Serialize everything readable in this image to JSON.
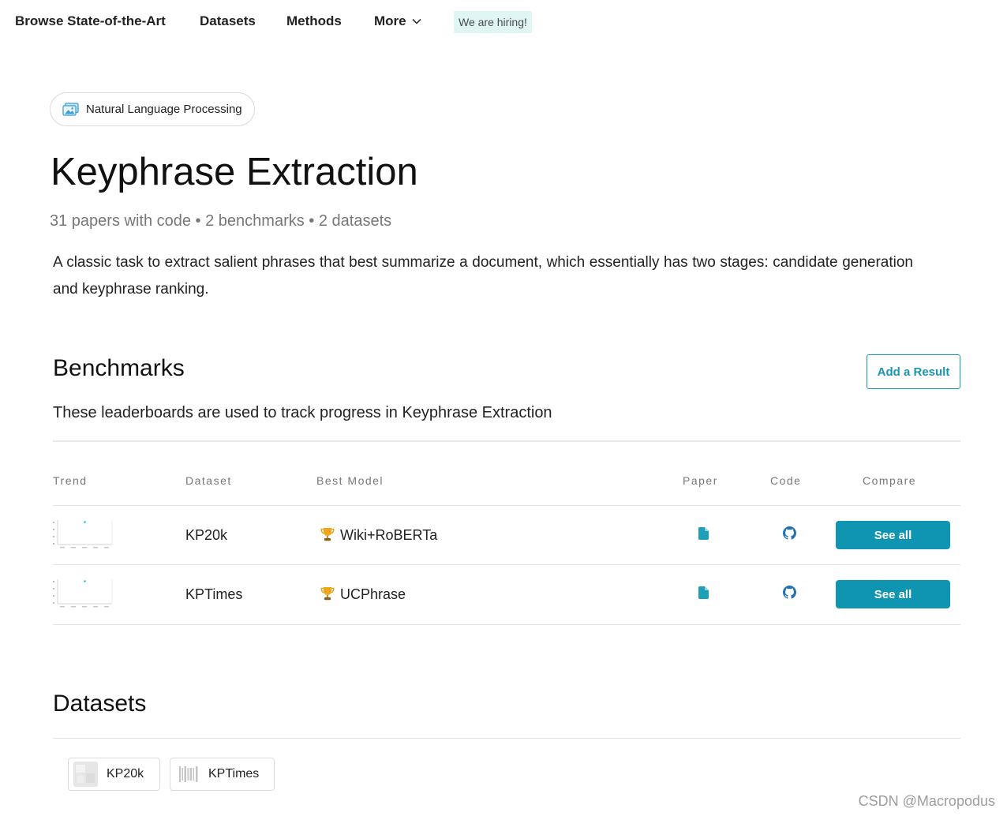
{
  "nav": {
    "browse": "Browse State-of-the-Art",
    "datasets": "Datasets",
    "methods": "Methods",
    "more": "More",
    "hiring": "We are hiring!"
  },
  "area": {
    "label": "Natural Language Processing",
    "icon": "image-icon"
  },
  "task": {
    "title": "Keyphrase Extraction",
    "stats": "31 papers with code • 2 benchmarks • 2 datasets",
    "description": "A classic task to extract salient phrases that best summarize a document, which essentially has two stages: candidate generation and keyphrase ranking."
  },
  "benchmarks": {
    "heading": "Benchmarks",
    "add_result": "Add a Result",
    "subtitle": "These leaderboards are used to track progress in Keyphrase Extraction",
    "columns": {
      "trend": "Trend",
      "dataset": "Dataset",
      "best_model": "Best Model",
      "paper": "Paper",
      "code": "Code",
      "compare": "Compare"
    },
    "rows": [
      {
        "dataset": "KP20k",
        "best_model": "Wiki+RoBERTa",
        "compare": "See all"
      },
      {
        "dataset": "KPTimes",
        "best_model": "UCPhrase",
        "compare": "See all"
      }
    ]
  },
  "datasets": {
    "heading": "Datasets",
    "items": [
      {
        "name": "KP20k"
      },
      {
        "name": "KPTimes"
      }
    ]
  },
  "watermark": "CSDN @Macropodus",
  "icons": {
    "more": "chevron-down-icon",
    "best_model": "trophy-icon",
    "paper": "file-icon",
    "code": "github-icon",
    "trend": "trend-sparkline"
  },
  "colors": {
    "accent": "#0f95b1",
    "accent_outline": "#1a96b0",
    "hiring_badge_bg": "#dff6f5",
    "code_icon": "#2173b5",
    "trend_point": "#21c4cf"
  }
}
